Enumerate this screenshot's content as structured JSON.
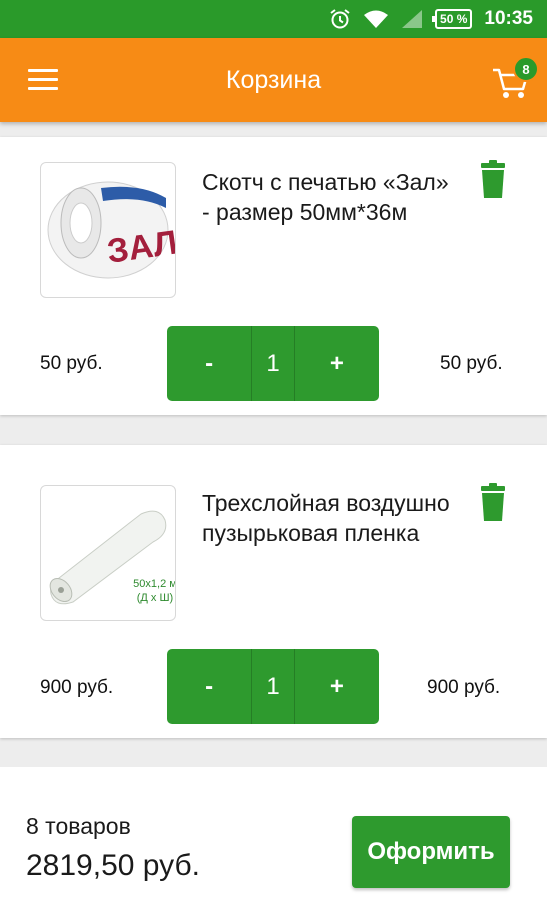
{
  "status_bar": {
    "battery": "50 %",
    "time": "10:35",
    "icons": [
      "alarm-icon",
      "wifi-icon",
      "signal-icon",
      "battery-icon"
    ]
  },
  "app_bar": {
    "title": "Корзина",
    "cart_badge": "8",
    "menu_icon": "hamburger-icon",
    "cart_icon": "cart-icon"
  },
  "items": [
    {
      "name": "Скотч с печатью «Зал» - размер 50мм*36м",
      "unit_price": "50 руб.",
      "quantity": "1",
      "minus_label": "-",
      "plus_label": "+",
      "total_price": "50 руб.",
      "image_text": "ЗАЛ"
    },
    {
      "name": "Трехслойная воздушно пузырьковая пленка",
      "unit_price": "900 руб.",
      "quantity": "1",
      "minus_label": "-",
      "plus_label": "+",
      "total_price": "900 руб.",
      "image_caption_line1": "50х1,2 м",
      "image_caption_line2": "(Д х Ш)"
    }
  ],
  "summary": {
    "count": "8 товаров",
    "total": "2819,50 руб.",
    "order_button": "Оформить"
  },
  "colors": {
    "status_bar": "#2a9a2a",
    "app_bar": "#f78b15",
    "accent_green": "#2e9a2e"
  }
}
